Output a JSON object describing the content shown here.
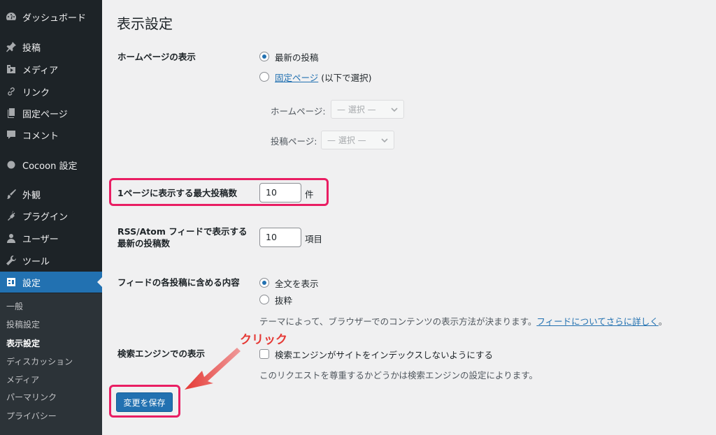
{
  "sidebar": {
    "items": [
      {
        "label": "ダッシュボード",
        "icon": "dashboard-icon"
      },
      {
        "label": "投稿",
        "icon": "pin-icon"
      },
      {
        "label": "メディア",
        "icon": "media-icon"
      },
      {
        "label": "リンク",
        "icon": "link-icon"
      },
      {
        "label": "固定ページ",
        "icon": "page-icon"
      },
      {
        "label": "コメント",
        "icon": "comment-icon"
      },
      {
        "label": "Cocoon 設定",
        "icon": "circle-icon"
      },
      {
        "label": "外観",
        "icon": "brush-icon"
      },
      {
        "label": "プラグイン",
        "icon": "plugin-icon"
      },
      {
        "label": "ユーザー",
        "icon": "user-icon"
      },
      {
        "label": "ツール",
        "icon": "wrench-icon"
      },
      {
        "label": "設定",
        "icon": "settings-icon"
      }
    ],
    "submenu": [
      "一般",
      "投稿設定",
      "表示設定",
      "ディスカッション",
      "メディア",
      "パーマリンク",
      "プライバシー"
    ]
  },
  "page": {
    "title": "表示設定",
    "homepage_display": {
      "label": "ホームページの表示",
      "option_latest": "最新の投稿",
      "option_static_link": "固定ページ",
      "option_static_rest": " (以下で選択)",
      "homepage_label": "ホームページ:",
      "posts_page_label": "投稿ページ:",
      "select_placeholder": "— 選択 —"
    },
    "posts_per_page": {
      "label": "1ページに表示する最大投稿数",
      "value": "10",
      "unit": "件"
    },
    "feed_count": {
      "label_line1": "RSS/Atom フィードで表示する",
      "label_line2": "最新の投稿数",
      "value": "10",
      "unit": "項目"
    },
    "feed_content": {
      "label": "フィードの各投稿に含める内容",
      "option_full": "全文を表示",
      "option_excerpt": "抜粋",
      "description": "テーマによって、ブラウザーでのコンテンツの表示方法が決まります。",
      "description_link": "フィードについてさらに詳しく",
      "description_end": "。"
    },
    "search_engine": {
      "label": "検索エンジンでの表示",
      "checkbox_label": "検索エンジンがサイトをインデックスしないようにする",
      "description": "このリクエストを尊重するかどうかは検索エンジンの設定によります。"
    },
    "save_button": "変更を保存",
    "annotation": "クリック"
  },
  "colors": {
    "accent": "#2271b1",
    "highlight": "#e91e63",
    "annotation": "#e53935",
    "sidebar": "#1d2327"
  }
}
